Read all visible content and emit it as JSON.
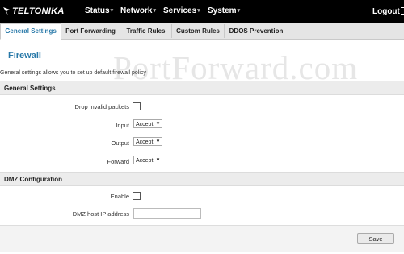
{
  "brand": {
    "name": "TELTONIKA"
  },
  "nav": {
    "items": [
      {
        "label": "Status"
      },
      {
        "label": "Network"
      },
      {
        "label": "Services"
      },
      {
        "label": "System"
      }
    ],
    "logout_label": "Logout"
  },
  "tabs": [
    {
      "label": "General Settings",
      "active": true
    },
    {
      "label": "Port Forwarding",
      "active": false
    },
    {
      "label": "Traffic Rules",
      "active": false
    },
    {
      "label": "Custom Rules",
      "active": false
    },
    {
      "label": "DDOS Prevention",
      "active": false
    }
  ],
  "watermark": "PortForward.com",
  "page": {
    "title": "Firewall",
    "description": "General settings allows you to set up default firewall policy"
  },
  "general_settings": {
    "header": "General Settings",
    "drop_invalid_label": "Drop invalid packets",
    "drop_invalid_checked": false,
    "input_label": "Input",
    "input_value": "Accept",
    "output_label": "Output",
    "output_value": "Accept",
    "forward_label": "Forward",
    "forward_value": "Accept"
  },
  "dmz": {
    "header": "DMZ Configuration",
    "enable_label": "Enable",
    "enable_checked": false,
    "host_ip_label": "DMZ host IP address",
    "host_ip_value": ""
  },
  "footer": {
    "save_label": "Save"
  },
  "colors": {
    "accent": "#2778a8",
    "navbar": "#000000"
  }
}
